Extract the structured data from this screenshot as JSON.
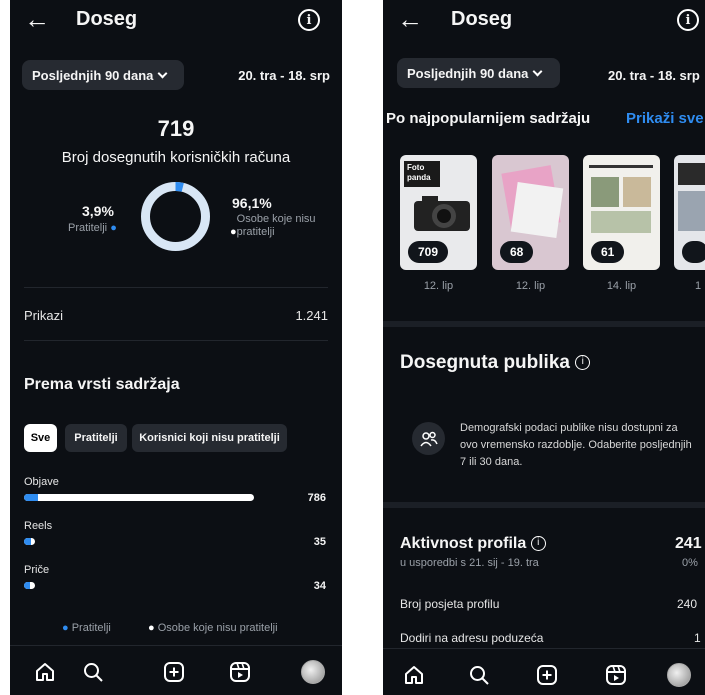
{
  "left": {
    "header": {
      "title": "Doseg"
    },
    "period": {
      "label": "Posljednjih 90 dana",
      "range": "20. tra - 18. srp"
    },
    "reach": {
      "value": "719",
      "label": "Broj dosegnutih korisničkih računa"
    },
    "split": {
      "followers_pct": "3,9%",
      "followers_label": "Pratitelji",
      "nonfollowers_pct": "96,1%",
      "nonfollowers_label_1": "Osobe koje nisu",
      "nonfollowers_label_2": "pratitelji",
      "followers_fraction": 0.039
    },
    "impressions": {
      "label": "Prikazi",
      "value": "1.241"
    },
    "content_type": {
      "title": "Prema vrsti sadržaja",
      "filters": [
        "Sve",
        "Pratitelji",
        "Korisnici koji nisu pratitelji"
      ],
      "rows": [
        {
          "label": "Objave",
          "value": "786"
        },
        {
          "label": "Reels",
          "value": "35"
        },
        {
          "label": "Priče",
          "value": "34"
        }
      ],
      "legend": {
        "followers": "Pratitelji",
        "nonfollowers": "Osobe koje nisu pratitelji"
      }
    }
  },
  "right": {
    "header": {
      "title": "Doseg"
    },
    "period": {
      "label": "Posljednjih 90 dana",
      "range": "20. tra - 18. srp"
    },
    "top_content": {
      "title": "Po najpopularnijem sadržaju",
      "link": "Prikaži sve",
      "items": [
        {
          "value": "709",
          "date": "12. lip"
        },
        {
          "value": "68",
          "date": "12. lip"
        },
        {
          "value": "61",
          "date": "14. lip"
        },
        {
          "value": "",
          "date": "1"
        }
      ]
    },
    "audience": {
      "title": "Dosegnuta publika",
      "message_1": "Demografski podaci publike nisu dostupni za",
      "message_2": "ovo vremensko razdoblje. Odaberite posljednjih",
      "message_3": "7 ili 30 dana."
    },
    "activity": {
      "title": "Aktivnost profila",
      "subtitle": "u usporedbi s 21. sij - 19. tra",
      "total": "241",
      "change": "0%",
      "rows": [
        {
          "label": "Broj posjeta profilu",
          "value": "240"
        },
        {
          "label": "Dodiri na adresu poduzeća",
          "value": "1"
        }
      ]
    }
  },
  "colors": {
    "background": "#0c0f14",
    "accent": "#2f8cf0",
    "muted": "#9aa0a8"
  }
}
